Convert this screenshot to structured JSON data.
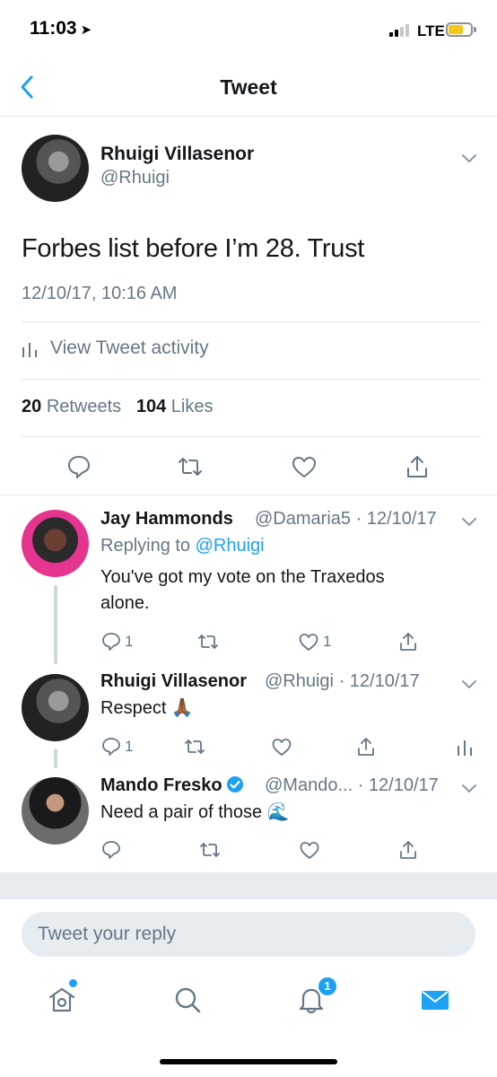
{
  "status_bar": {
    "time": "11:03",
    "carrier": "LTE"
  },
  "nav": {
    "title": "Tweet"
  },
  "main_tweet": {
    "name": "Rhuigi Villasenor",
    "handle": "@Rhuigi",
    "text": "Forbes list before I’m 28. Trust",
    "timestamp": "12/10/17, 10:16 AM",
    "activity_label": "View Tweet activity",
    "retweet_count": "20",
    "retweet_label": "Retweets",
    "like_count": "104",
    "like_label": "Likes"
  },
  "replies": [
    {
      "name": "Jay Hammonds",
      "handle": "@Damaria5",
      "date": "· 12/10/17",
      "replying_prefix": "Replying to",
      "replying_handle": "@Rhuigi",
      "text_line1": "You've got my vote on the Traxedos",
      "text_line2": "alone.",
      "reply_count": "1",
      "like_count": "1"
    },
    {
      "name": "Rhuigi Villasenor",
      "handle": "@Rhuigi",
      "date": "· 12/10/17",
      "text": "Respect 🙏🏾",
      "reply_count": "1"
    },
    {
      "name": "Mando Fresko",
      "handle": "@Mando...",
      "date": "· 12/10/17",
      "text": "Need a pair of those 🌊",
      "verified": true
    }
  ],
  "reply_bar": {
    "placeholder": "Tweet your reply"
  },
  "tab_bar": {
    "notifications_badge": "1"
  },
  "colors": {
    "accent": "#1da1f2",
    "secondary_text": "#657786",
    "divider": "#e1e8ed",
    "thread_line": "#ccd6dd"
  },
  "icons": [
    "back-icon",
    "chevron-down-icon",
    "stats-icon",
    "reply-icon",
    "retweet-icon",
    "like-icon",
    "share-icon",
    "verified-icon",
    "home-icon",
    "search-icon",
    "notifications-icon",
    "messages-icon"
  ]
}
